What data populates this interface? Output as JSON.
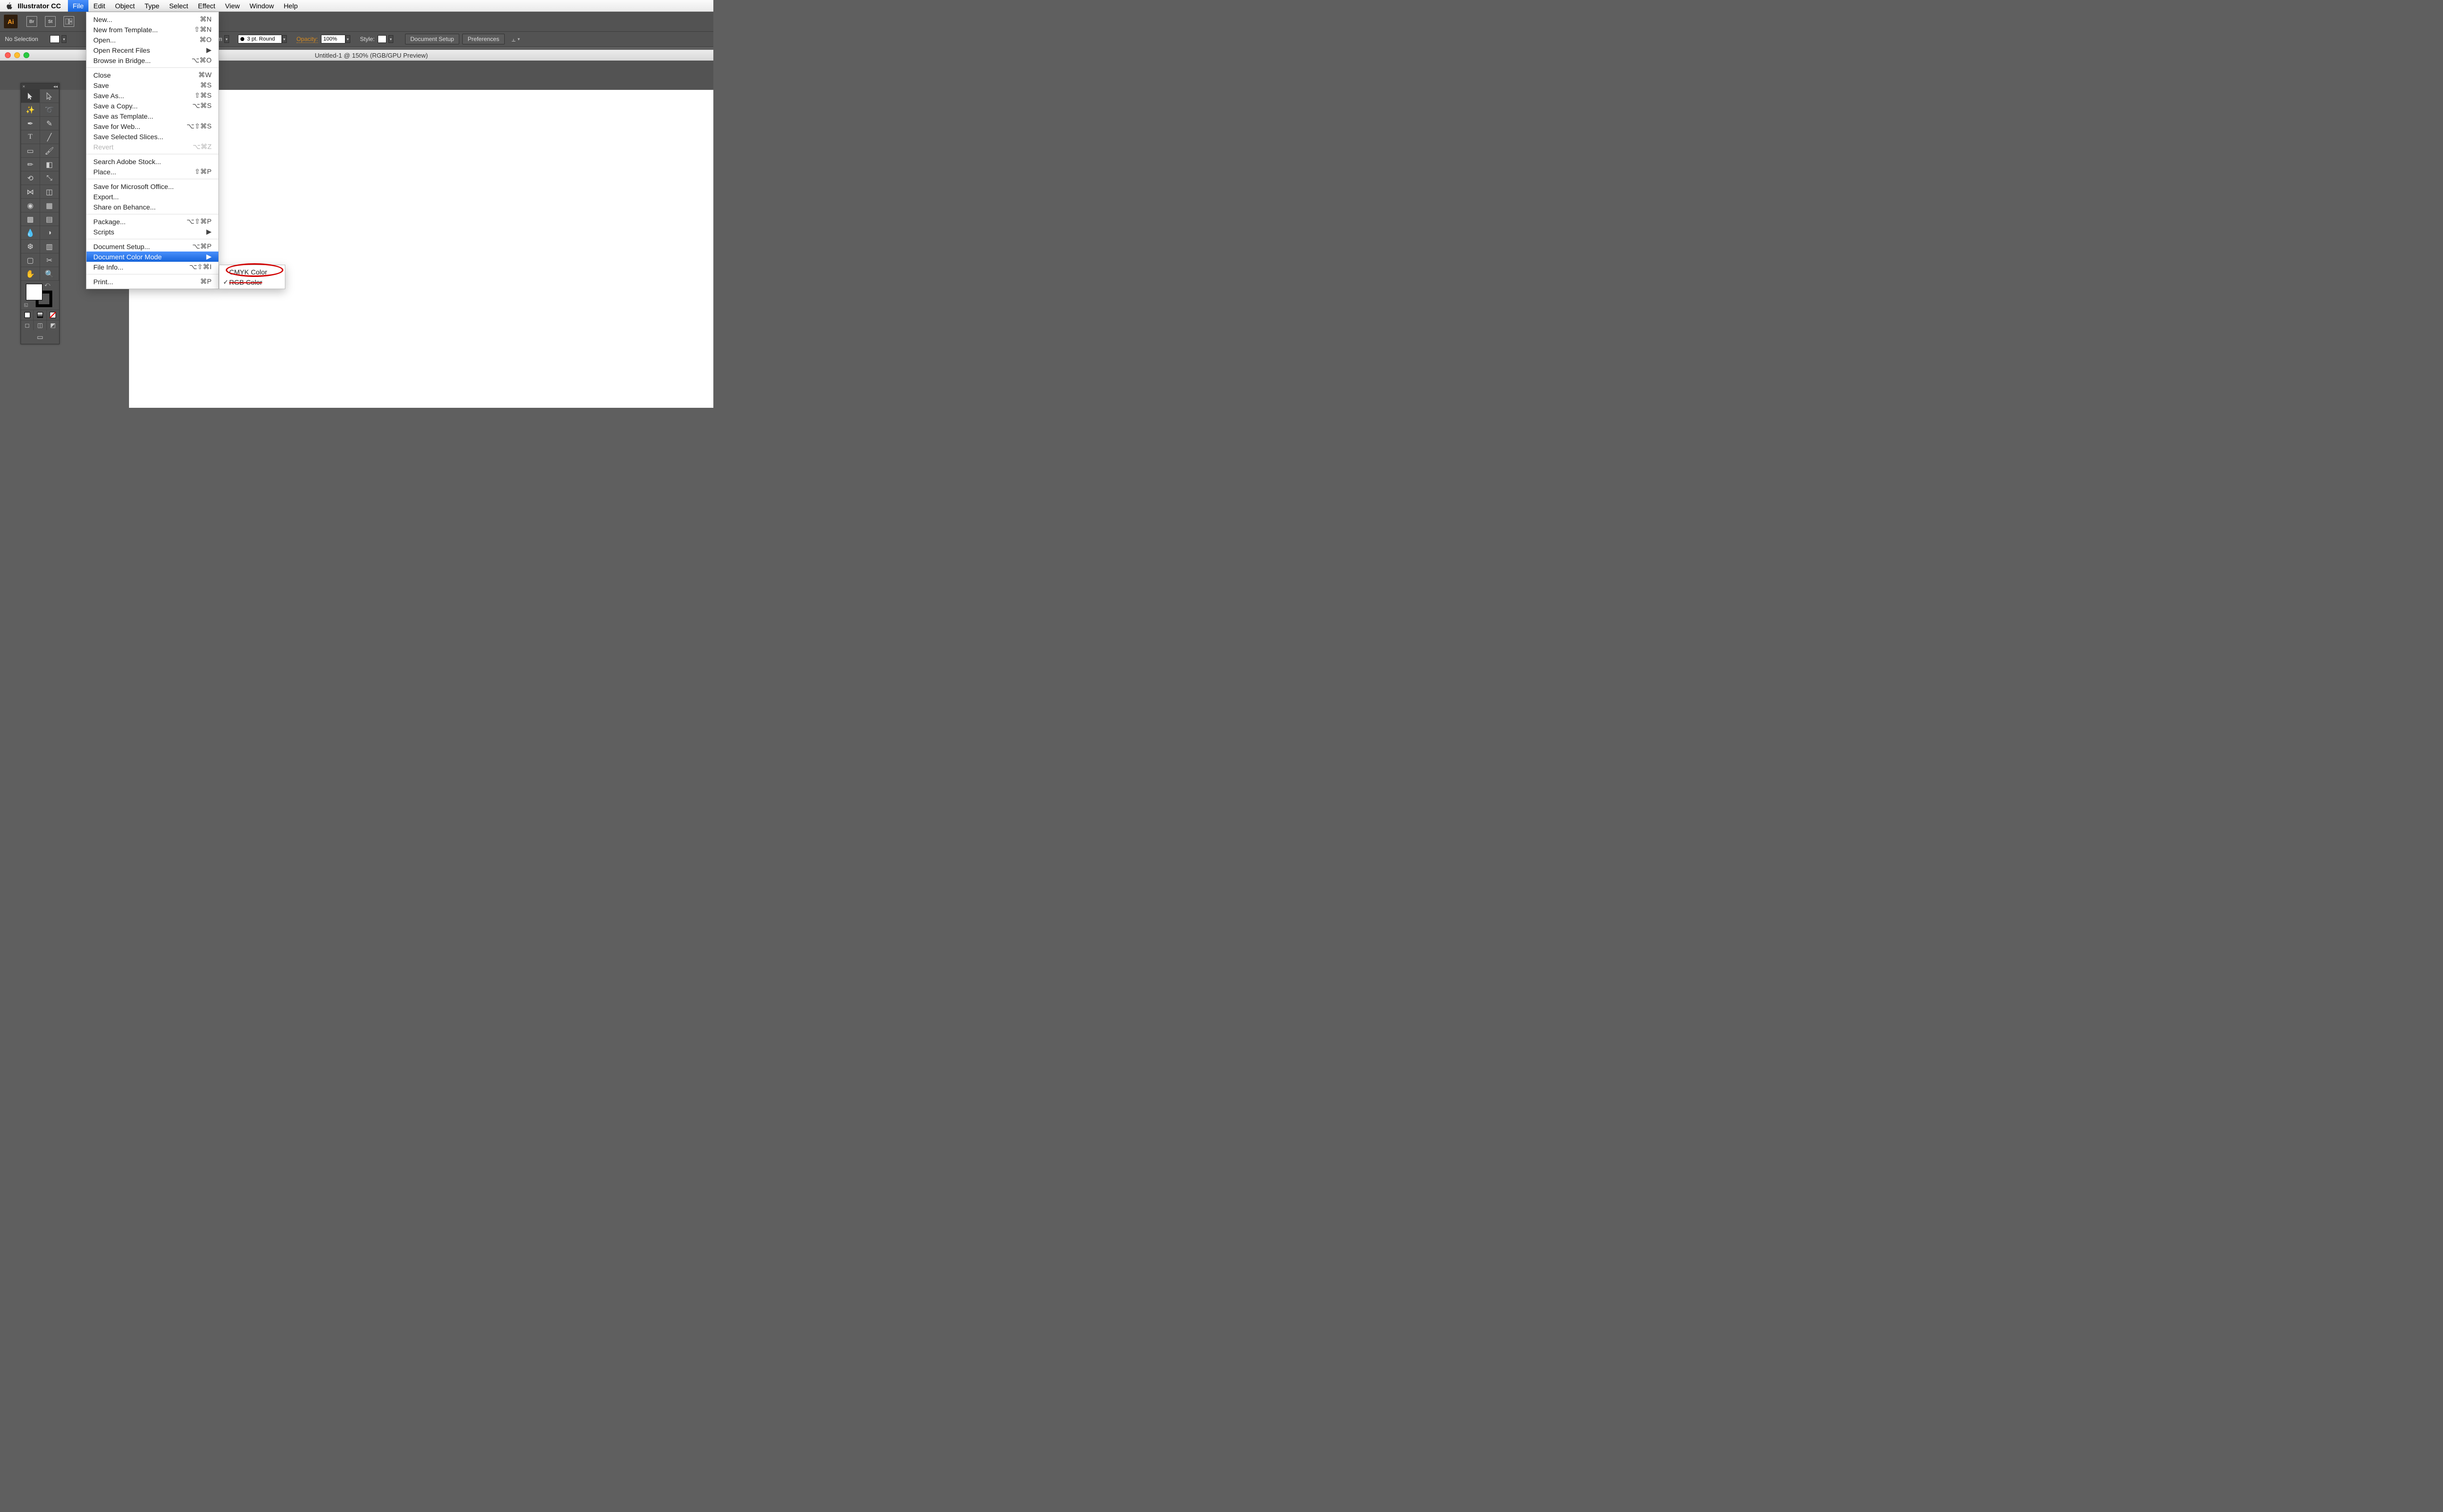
{
  "macmenu": {
    "app": "Illustrator CC",
    "items": [
      "File",
      "Edit",
      "Object",
      "Type",
      "Select",
      "Effect",
      "View",
      "Window",
      "Help"
    ],
    "selected": "File"
  },
  "apptop": {
    "ai": "Ai",
    "br": "Br",
    "st": "St"
  },
  "optionsbar": {
    "selection": "No Selection",
    "stroke_behind": "orm",
    "stroke_value": "3 pt. Round",
    "opacity_label": "Opacity:",
    "opacity_value": "100%",
    "style_label": "Style:",
    "doc_setup": "Document Setup",
    "preferences": "Preferences"
  },
  "doc": {
    "title": "Untitled-1 @ 150% (RGB/GPU Preview)"
  },
  "filemenu": [
    {
      "label": "New...",
      "sc": "⌘N"
    },
    {
      "label": "New from Template...",
      "sc": "⇧⌘N"
    },
    {
      "label": "Open...",
      "sc": "⌘O"
    },
    {
      "label": "Open Recent Files",
      "submenu": true
    },
    {
      "label": "Browse in Bridge...",
      "sc": "⌥⌘O"
    },
    {
      "sep": true
    },
    {
      "label": "Close",
      "sc": "⌘W"
    },
    {
      "label": "Save",
      "sc": "⌘S"
    },
    {
      "label": "Save As...",
      "sc": "⇧⌘S"
    },
    {
      "label": "Save a Copy...",
      "sc": "⌥⌘S"
    },
    {
      "label": "Save as Template..."
    },
    {
      "label": "Save for Web...",
      "sc": "⌥⇧⌘S"
    },
    {
      "label": "Save Selected Slices..."
    },
    {
      "label": "Revert",
      "sc": "⌥⌘Z",
      "disabled": true
    },
    {
      "sep": true
    },
    {
      "label": "Search Adobe Stock..."
    },
    {
      "label": "Place...",
      "sc": "⇧⌘P"
    },
    {
      "sep": true
    },
    {
      "label": "Save for Microsoft Office..."
    },
    {
      "label": "Export..."
    },
    {
      "label": "Share on Behance..."
    },
    {
      "sep": true
    },
    {
      "label": "Package...",
      "sc": "⌥⇧⌘P"
    },
    {
      "label": "Scripts",
      "submenu": true
    },
    {
      "sep": true
    },
    {
      "label": "Document Setup...",
      "sc": "⌥⌘P"
    },
    {
      "label": "Document Color Mode",
      "submenu": true,
      "selected": true
    },
    {
      "label": "File Info...",
      "sc": "⌥⇧⌘I"
    },
    {
      "sep": true
    },
    {
      "label": "Print...",
      "sc": "⌘P"
    }
  ],
  "colormode": {
    "cmyk": "CMYK Color",
    "rgb": "RGB Color",
    "checked": "rgb"
  },
  "tools": [
    "selection",
    "direct-selection",
    "magic-wand",
    "lasso",
    "pen",
    "curvature",
    "type",
    "line",
    "rectangle",
    "paintbrush",
    "pencil",
    "eraser",
    "rotate",
    "scale",
    "width",
    "free-transform",
    "shape-builder",
    "perspective",
    "mesh",
    "gradient",
    "eyedropper",
    "blend",
    "symbol-sprayer",
    "graph",
    "artboard",
    "slice",
    "hand",
    "zoom"
  ]
}
